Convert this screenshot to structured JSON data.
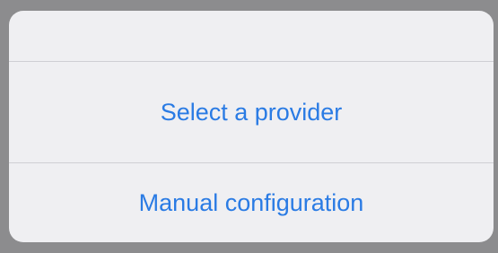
{
  "action_sheet": {
    "top_item": "",
    "items": [
      {
        "label": "Select a provider"
      },
      {
        "label": "Manual configuration"
      }
    ],
    "colors": {
      "accent": "#2a7be4",
      "sheet_background": "#efeff2",
      "backdrop": "#8c8c8e",
      "divider": "#cfcfd4"
    }
  }
}
